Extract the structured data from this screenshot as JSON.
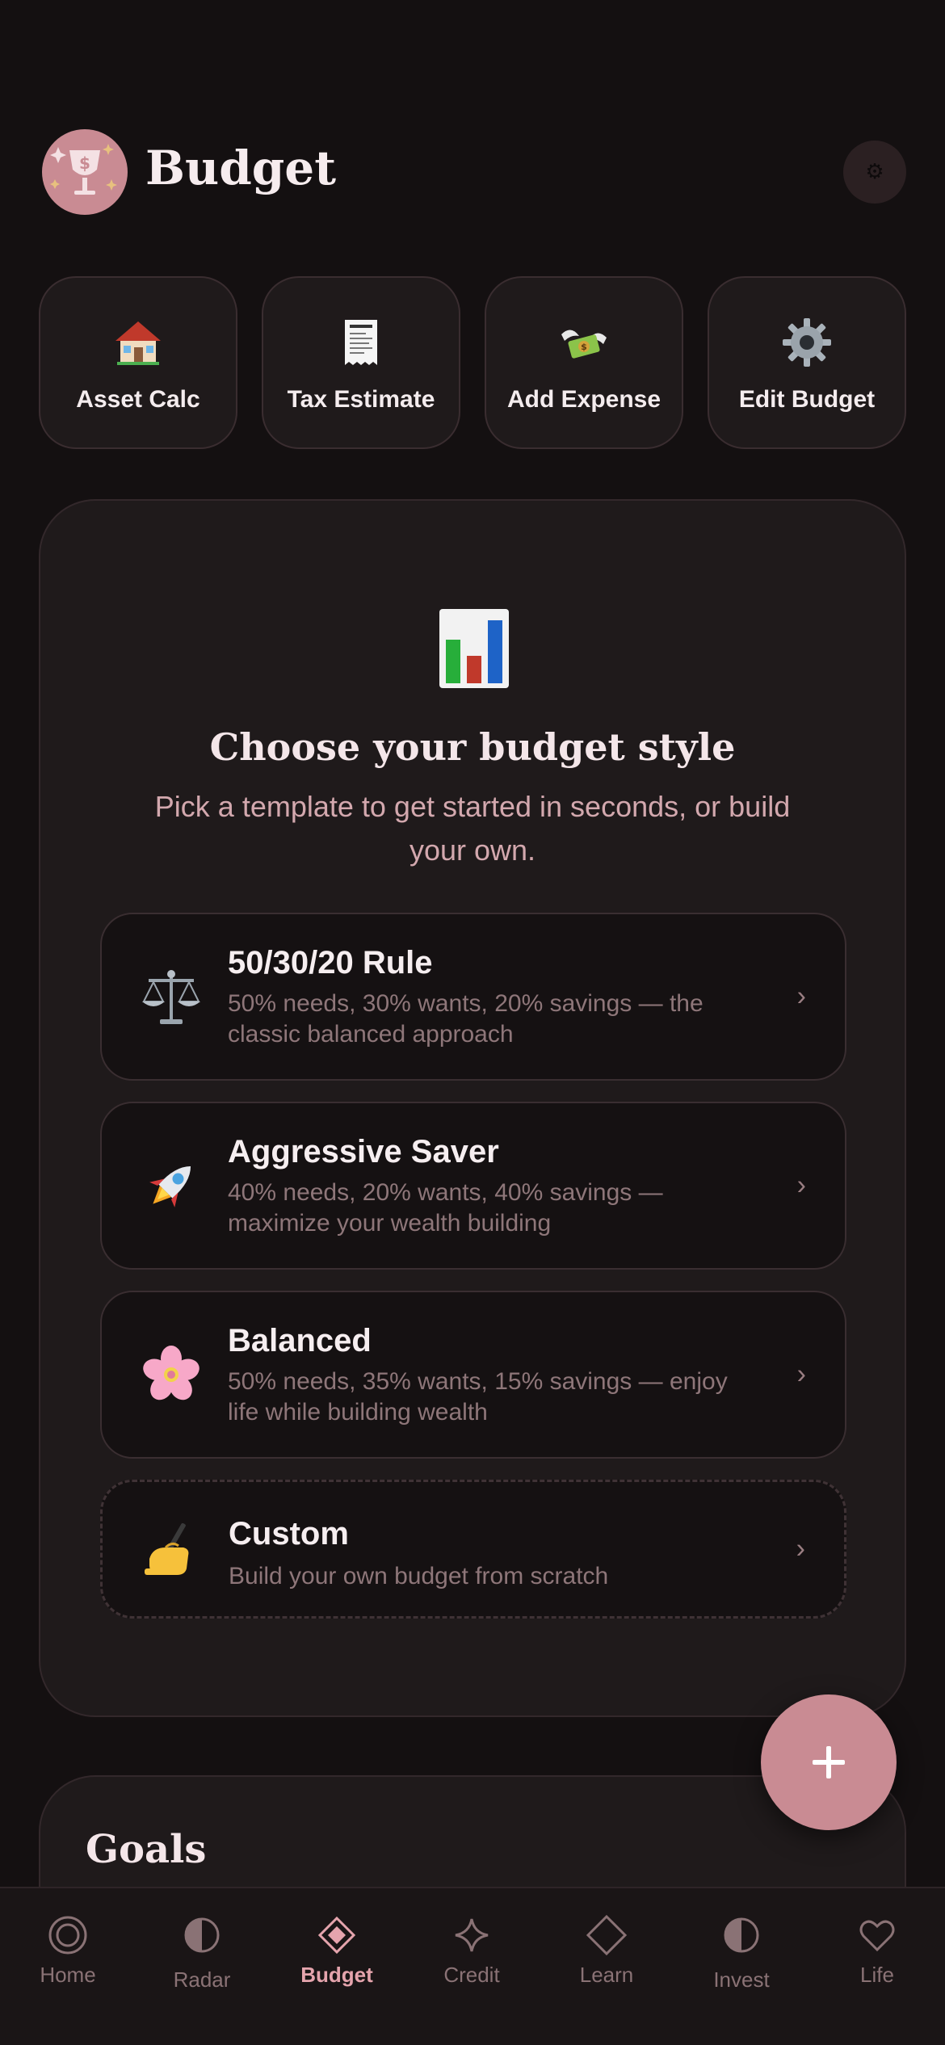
{
  "header": {
    "title": "Budget",
    "settings_icon": "gear-icon"
  },
  "quick_actions": [
    {
      "label": "Asset Calc",
      "icon": "house-icon"
    },
    {
      "label": "Tax Estimate",
      "icon": "receipt-icon"
    },
    {
      "label": "Add Expense",
      "icon": "money-wings-icon"
    },
    {
      "label": "Edit Budget",
      "icon": "gear-icon"
    }
  ],
  "template_card": {
    "icon": "bar-chart-icon",
    "title": "Choose your budget style",
    "subtitle": "Pick a template to get started in seconds, or build your own.",
    "options": [
      {
        "title": "50/30/20 Rule",
        "desc": "50% needs, 30% wants, 20% savings — the classic balanced approach",
        "icon": "scales-icon"
      },
      {
        "title": "Aggressive Saver",
        "desc": "40% needs, 20% wants, 40% savings — maximize your wealth building",
        "icon": "rocket-icon"
      },
      {
        "title": "Balanced",
        "desc": "50% needs, 35% wants, 15% savings — enjoy life while building wealth",
        "icon": "blossom-icon"
      },
      {
        "title": "Custom",
        "desc": "Build your own budget from scratch",
        "icon": "writing-hand-icon"
      }
    ],
    "chevron": "›"
  },
  "fab": {
    "icon": "plus-icon"
  },
  "goals": {
    "title": "Goals"
  },
  "nav": [
    {
      "label": "Home",
      "icon": "ring-icon"
    },
    {
      "label": "Radar",
      "icon": "half-circle-icon"
    },
    {
      "label": "Budget",
      "icon": "diamond-icon",
      "active": true
    },
    {
      "label": "Credit",
      "icon": "sparkle-icon"
    },
    {
      "label": "Learn",
      "icon": "diamond-outline-icon"
    },
    {
      "label": "Invest",
      "icon": "half-circle-icon"
    },
    {
      "label": "Life",
      "icon": "heart-icon"
    }
  ],
  "colors": {
    "accent": "#c98b93",
    "background": "#141011",
    "card": "#1f1a1b",
    "active_nav": "#e5a4ad"
  }
}
